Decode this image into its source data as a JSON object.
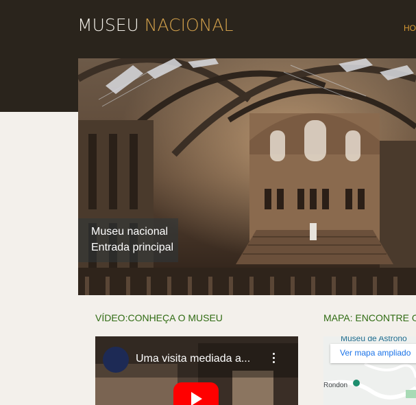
{
  "header": {
    "logo_main": "MUSEU ",
    "logo_accent": "NACIONAL",
    "nav_home": "HO"
  },
  "hero": {
    "caption_line1": "Museu nacional",
    "caption_line2": "Entrada principal"
  },
  "video_section": {
    "heading": "VÍDEO:CONHEÇA O MUSEU",
    "video_title": "Uma visita mediada a..."
  },
  "map_section": {
    "heading": "MAPA: ENCONTRE O",
    "place_name": "Museu de Astrono",
    "map_link": "Ver mapa ampliado",
    "street_label": "Rondon"
  },
  "colors": {
    "header_bg": "#2a241c",
    "logo_accent": "#d4a24c",
    "section_heading": "#2f6b12",
    "page_bg": "#f3f0eb"
  }
}
